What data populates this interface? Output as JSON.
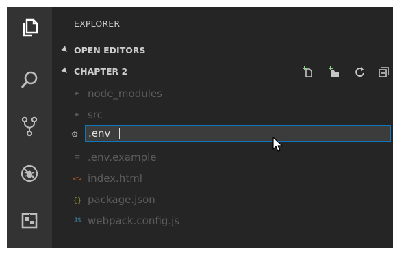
{
  "sidebar": {
    "title": "EXPLORER",
    "sections": [
      {
        "label": "OPEN EDITORS",
        "expanded": true
      },
      {
        "label": "CHAPTER 2",
        "expanded": true
      }
    ],
    "toolbar": [
      "new-file-icon",
      "new-folder-icon",
      "refresh-icon",
      "collapse-all-icon"
    ]
  },
  "tree": {
    "items": [
      {
        "name": "node_modules",
        "icon": "chevron-right-icon",
        "icon_glyph": "▶"
      },
      {
        "name": "src",
        "icon": "chevron-right-icon",
        "icon_glyph": "▶"
      },
      {
        "name": "",
        "icon": "gear-icon",
        "icon_glyph": "⚙"
      },
      {
        "name": ".env.example",
        "icon": "lines-icon",
        "icon_glyph": "≡"
      },
      {
        "name": "index.html",
        "icon": "html-icon",
        "icon_glyph": "<>"
      },
      {
        "name": "package.json",
        "icon": "json-icon",
        "icon_glyph": "{}"
      },
      {
        "name": "webpack.config.js",
        "icon": "js-icon",
        "icon_glyph": "JS"
      }
    ],
    "rename_value": ".env"
  },
  "colors": {
    "accent": "#1177bb",
    "html_icon": "#e37933",
    "json_icon": "#cbcb41",
    "js_icon": "#519aba",
    "gear_icon": "#a0a0a0"
  }
}
